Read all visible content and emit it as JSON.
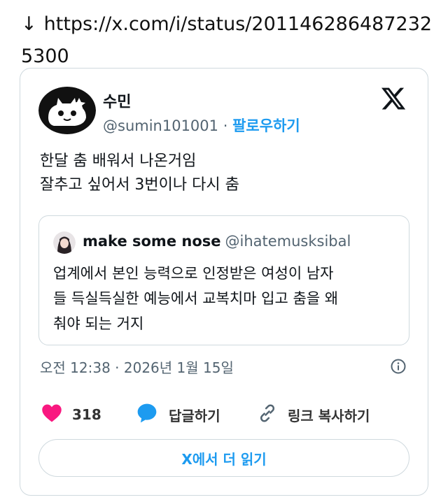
{
  "link": {
    "arrow": "↓",
    "url": "https://x.com/i/status/2011462864872325300"
  },
  "tweet": {
    "author_name": "수민",
    "author_handle": "@sumin101001",
    "separator": "·",
    "follow_label": "팔로우하기",
    "text_line1": "한달 춤 배워서 나온거임",
    "text_line2": "잘추고 싶어서 3번이나 다시 춤",
    "timestamp": "오전 12:38 · 2026년 1월 15일",
    "like_count": "318",
    "reply_label": "답글하기",
    "copy_link_label": "링크 복사하기",
    "read_more_label": "X에서 더 읽기"
  },
  "quoted": {
    "author_name": "make some nose",
    "author_handle": "@ihatemusksibal",
    "text_line1": "업계에서 본인 능력으로 인정받은 여성이 남자",
    "text_line2": "들 득실득실한 예능에서 교복치마 입고 춤을 왜",
    "text_line3": "춰야 되는 거지"
  },
  "icons": {
    "logo": "x-logo-icon",
    "info": "info-icon",
    "like": "heart-icon",
    "reply": "speech-bubble-icon",
    "link": "link-icon"
  },
  "colors": {
    "accent": "#1d9bf0",
    "like": "#f91880",
    "muted": "#536471",
    "border": "#cfd9de"
  }
}
